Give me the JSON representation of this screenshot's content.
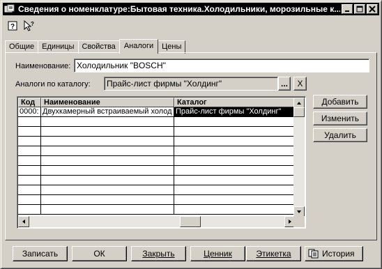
{
  "window": {
    "title": "Сведения о номенклатуре:Бытовая техника.Холодильники, морозильные к..."
  },
  "tabs": [
    "Общие",
    "Единицы",
    "Свойства",
    "Аналоги",
    "Цены"
  ],
  "form": {
    "name_label": "Наименование:",
    "name_value": "Холодильник \"BOSCH\"",
    "catalog_label": "Аналоги по каталогу:",
    "catalog_value": "Прайс-лист фирмы \"Холдинг\"",
    "browse_label": "...",
    "clear_label": "X"
  },
  "grid": {
    "columns": [
      "Код",
      "Наименование",
      "Каталог"
    ],
    "rows": [
      [
        "0000:",
        "Двухкамерный встраиваемый холод",
        "Прайс-лист фирмы \"Холдинг\""
      ]
    ]
  },
  "side_buttons": {
    "add": "Добавить",
    "edit": "Изменить",
    "delete": "Удалить"
  },
  "bottom_buttons": {
    "save": "Записать",
    "ok": "ОК",
    "close": "Закрыть",
    "price_tag": "Ценник",
    "label": "Этикетка",
    "history": "История"
  }
}
